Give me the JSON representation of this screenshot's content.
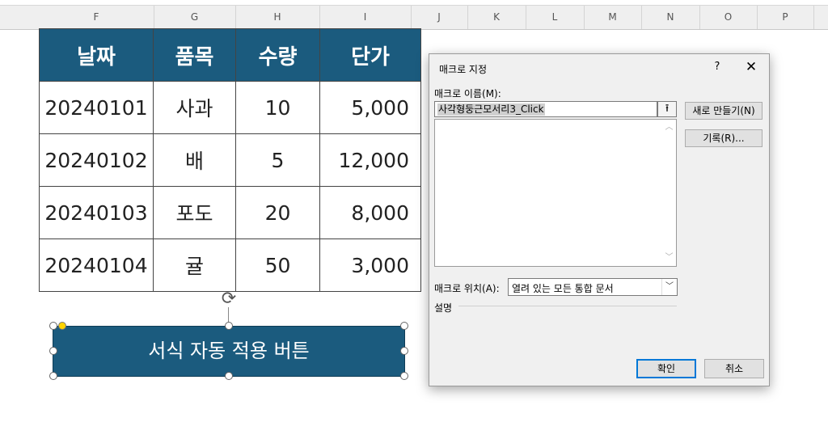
{
  "columns": [
    "F",
    "G",
    "H",
    "I",
    "J",
    "K",
    "L",
    "M",
    "N",
    "O",
    "P"
  ],
  "table": {
    "headers": [
      "날짜",
      "품목",
      "수량",
      "단가"
    ],
    "rows": [
      [
        "20240101",
        "사과",
        "10",
        "5,000"
      ],
      [
        "20240102",
        "배",
        "5",
        "12,000"
      ],
      [
        "20240103",
        "포도",
        "20",
        "8,000"
      ],
      [
        "20240104",
        "귤",
        "50",
        "3,000"
      ]
    ]
  },
  "shape_button": {
    "label": "서식 자동 적용 버튼",
    "fill_color": "#1b5b7e"
  },
  "colors": {
    "header_fill": "#1b5b7e",
    "header_text": "#ffffff"
  },
  "icons": {
    "rotate": "rotate-handle-icon",
    "close": "close-icon",
    "help": "help-icon"
  },
  "dialog": {
    "title": "매크로 지정",
    "help": "?",
    "close": "✕",
    "macro_name_label": "매크로 이름(M):",
    "macro_name_value": "사각형둥근모서리3_Click",
    "new_button": "새로 만들기(N)",
    "record_button": "기록(R)...",
    "location_label": "매크로 위치(A):",
    "location_value": "열려 있는 모든 통합 문서",
    "description_label": "설명",
    "ok_button": "확인",
    "cancel_button": "취소"
  }
}
